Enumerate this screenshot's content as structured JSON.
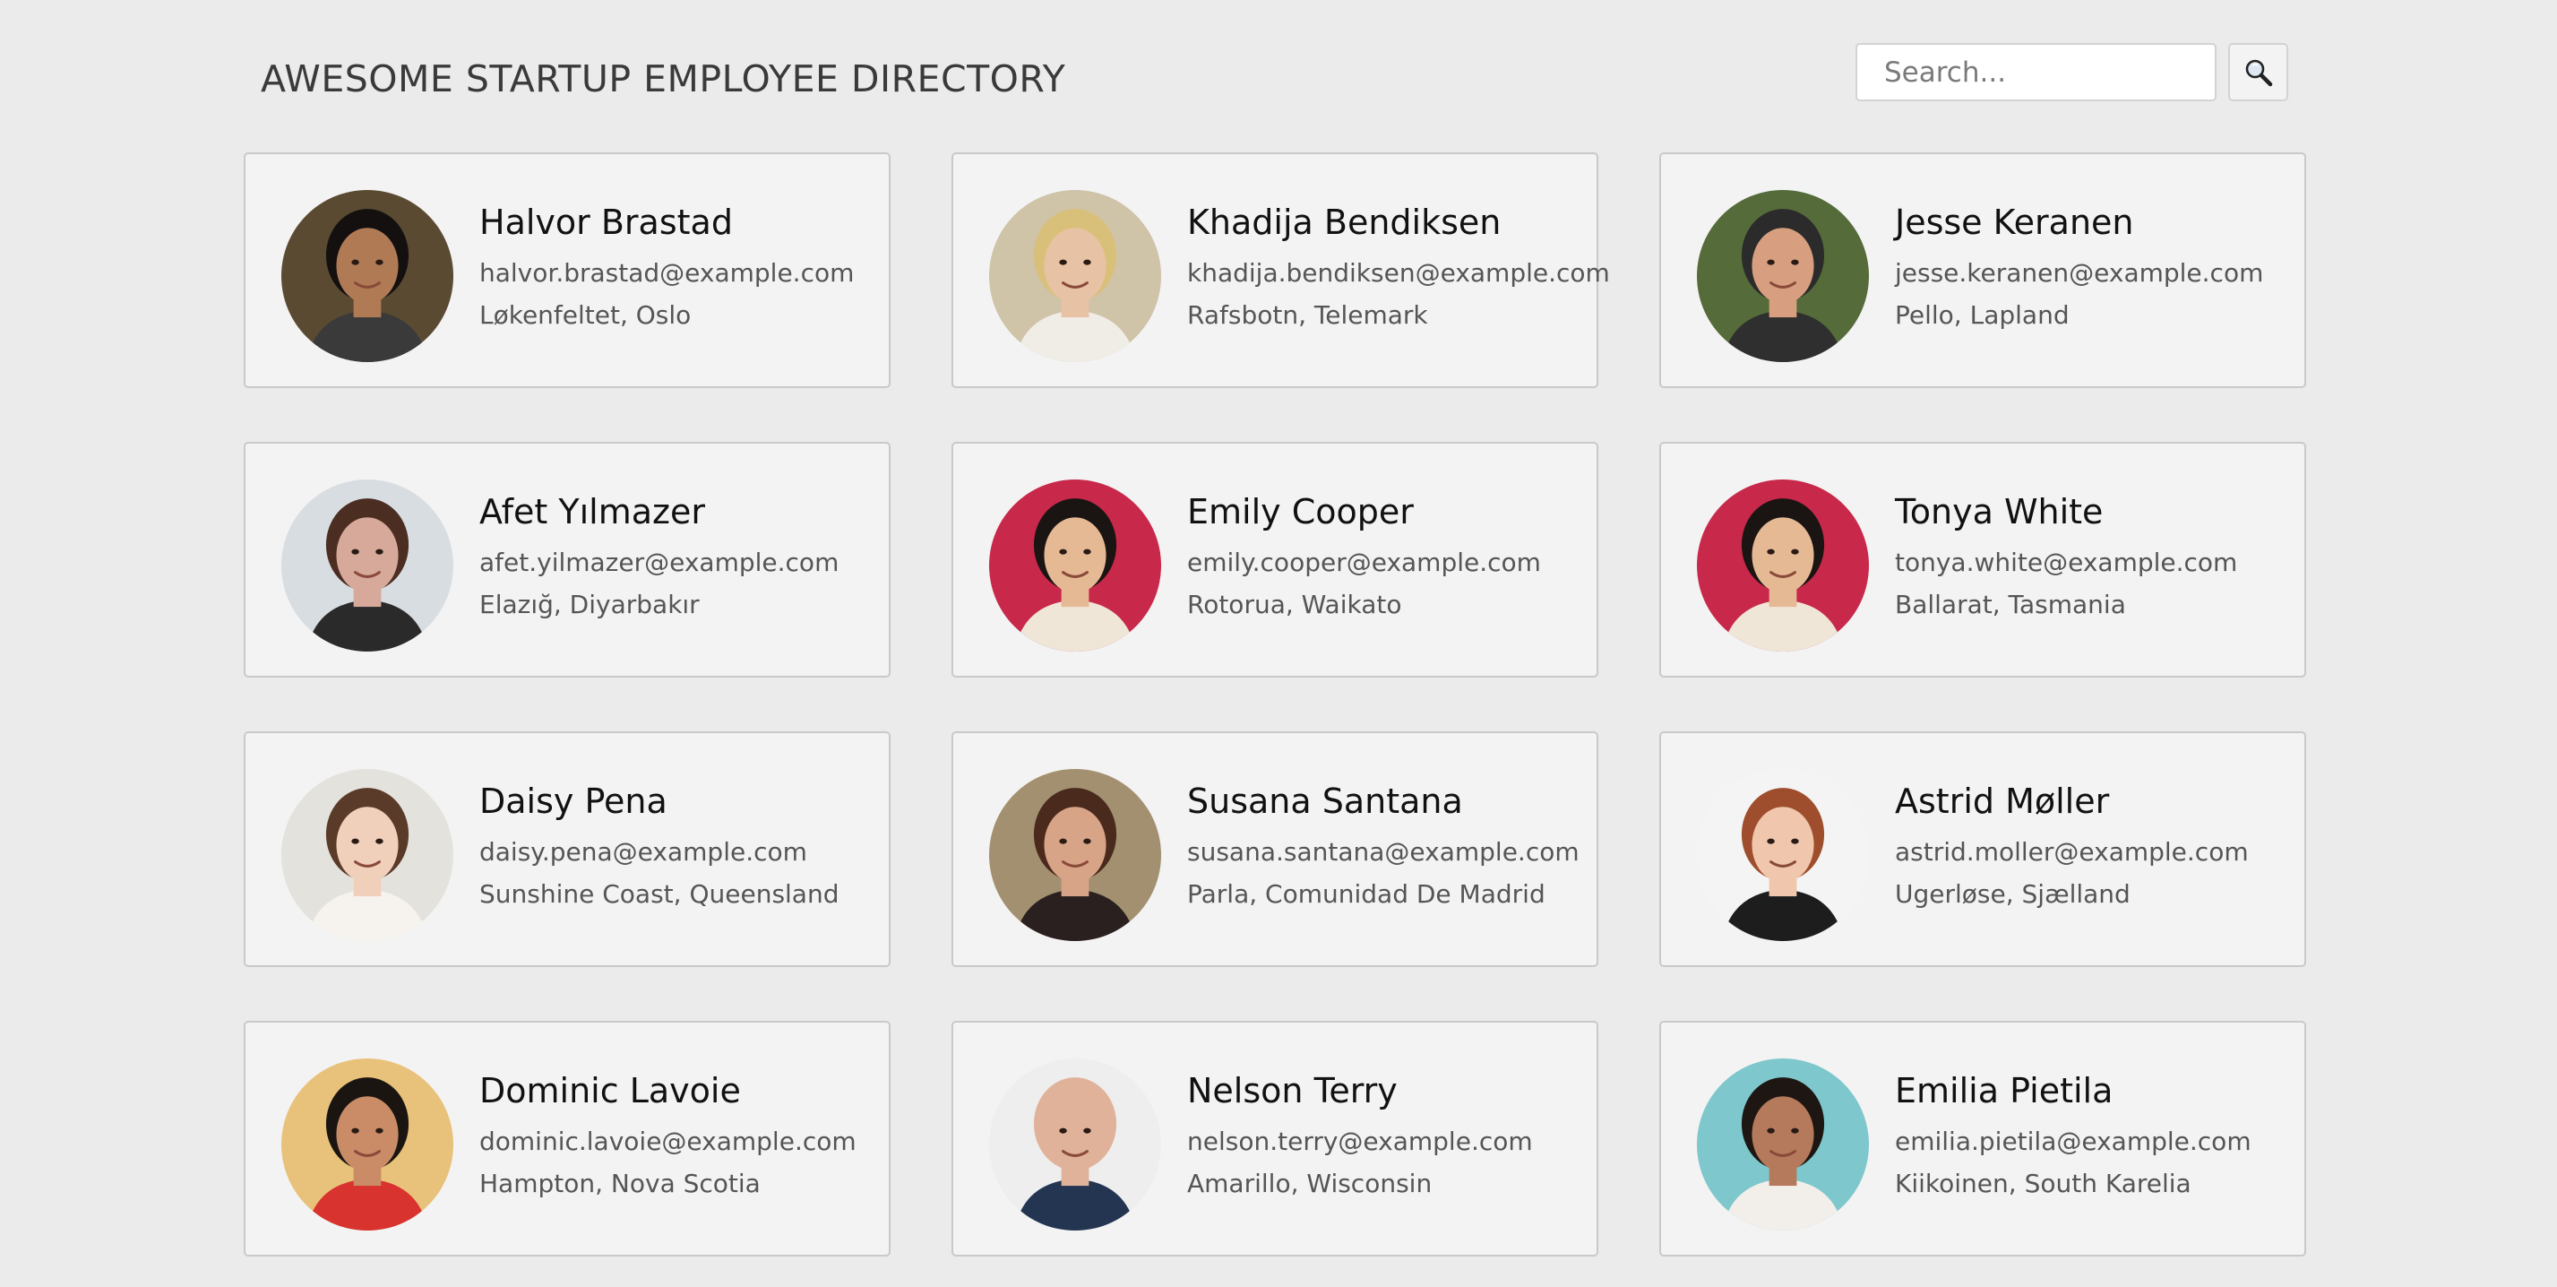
{
  "header": {
    "title": "AWESOME STARTUP EMPLOYEE DIRECTORY",
    "search_placeholder": "Search...",
    "search_icon": "magnifier-icon"
  },
  "employees": [
    {
      "name": "Halvor Brastad",
      "email": "halvor.brastad@example.com",
      "location": "Løkenfeltet, Oslo",
      "bg": "#5a4a32",
      "skin": "#b07a55",
      "hair": "#151010",
      "shirt": "#3a3a3a"
    },
    {
      "name": "Khadija Bendiksen",
      "email": "khadija.bendiksen@example.com",
      "location": "Rafsbotn, Telemark",
      "bg": "#cfc3a8",
      "skin": "#e8c2a4",
      "hair": "#d9c07a",
      "shirt": "#f0ece6"
    },
    {
      "name": "Jesse Keranen",
      "email": "jesse.keranen@example.com",
      "location": "Pello, Lapland",
      "bg": "#556b3a",
      "skin": "#d79f7f",
      "hair": "#2b2b2b",
      "shirt": "#2f2f2f"
    },
    {
      "name": "Afet Yılmazer",
      "email": "afet.yilmazer@example.com",
      "location": "Elazığ, Diyarbakır",
      "bg": "#d8dde2",
      "skin": "#d6a99b",
      "hair": "#4b2d22",
      "shirt": "#2a2a2a"
    },
    {
      "name": "Emily Cooper",
      "email": "emily.cooper@example.com",
      "location": "Rotorua, Waikato",
      "bg": "#c8284a",
      "skin": "#e6b995",
      "hair": "#1a1412",
      "shirt": "#efe6d8"
    },
    {
      "name": "Tonya White",
      "email": "tonya.white@example.com",
      "location": "Ballarat, Tasmania",
      "bg": "#c8284a",
      "skin": "#e6b995",
      "hair": "#1a1412",
      "shirt": "#efe6d8"
    },
    {
      "name": "Daisy Pena",
      "email": "daisy.pena@example.com",
      "location": "Sunshine Coast, Queensland",
      "bg": "#e4e2dc",
      "skin": "#f1d0bb",
      "hair": "#5a3a28",
      "shirt": "#f6f3ef"
    },
    {
      "name": "Susana Santana",
      "email": "susana.santana@example.com",
      "location": "Parla, Comunidad De Madrid",
      "bg": "#a39070",
      "skin": "#d8a488",
      "hair": "#4a2a1d",
      "shirt": "#2a2020"
    },
    {
      "name": "Astrid Møller",
      "email": "astrid.moller@example.com",
      "location": "Ugerløse, Sjælland",
      "bg": "#f4f4f4",
      "skin": "#f0c6ad",
      "hair": "#9e4e2c",
      "shirt": "#1d1d1d"
    },
    {
      "name": "Dominic Lavoie",
      "email": "dominic.lavoie@example.com",
      "location": "Hampton, Nova Scotia",
      "bg": "#e8c27a",
      "skin": "#c98c67",
      "hair": "#1b1512",
      "shirt": "#d8332e"
    },
    {
      "name": "Nelson Terry",
      "email": "nelson.terry@example.com",
      "location": "Amarillo, Wisconsin",
      "bg": "#eeeeee",
      "skin": "#e0b29a",
      "hair": "#e0b29a",
      "shirt": "#243552"
    },
    {
      "name": "Emilia Pietila",
      "email": "emilia.pietila@example.com",
      "location": "Kiikoinen, South Karelia",
      "bg": "#7ec7cc",
      "skin": "#b57a5c",
      "hair": "#1e1612",
      "shirt": "#f2efea"
    }
  ]
}
